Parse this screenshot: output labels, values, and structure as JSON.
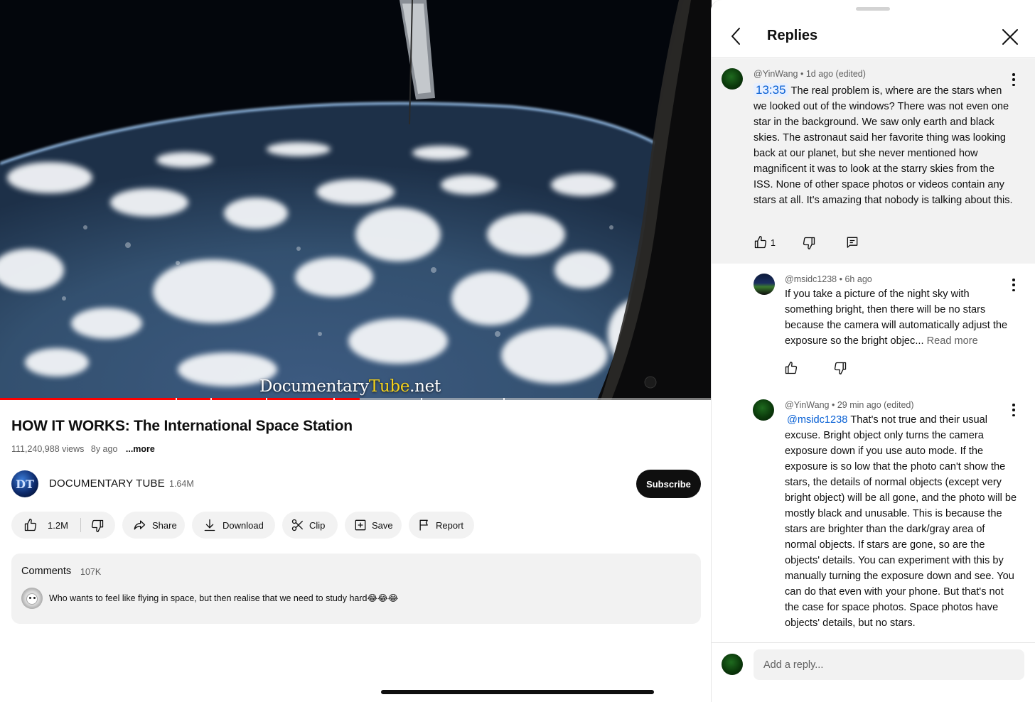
{
  "video": {
    "watermark_a": "Documentary",
    "watermark_b": "Tube",
    "watermark_c": ".net",
    "progress_fraction": 0.505,
    "title": "HOW IT WORKS: The International Space Station",
    "views": "111,240,988 views",
    "age": "8y ago",
    "more": "...more"
  },
  "channel": {
    "avatar_text": "DT",
    "name": "DOCUMENTARY TUBE",
    "subscribers": "1.64M",
    "subscribe_label": "Subscribe"
  },
  "actions": {
    "likes": "1.2M",
    "share": "Share",
    "download": "Download",
    "clip": "Clip",
    "save": "Save",
    "report": "Report"
  },
  "comments": {
    "title": "Comments",
    "count": "107K",
    "preview_text": "Who wants to feel like flying in space, but then realise that we need to study hard😂😂😂"
  },
  "replies_panel": {
    "title": "Replies",
    "input_placeholder": "Add a reply...",
    "parent": {
      "author": "@YinWang",
      "meta": "1d ago (edited)",
      "timestamp_link": "13:35",
      "text": "The real problem is, where are the stars when we looked out of the windows? There was not even one star in the background. We saw only earth and black skies. The astronaut said her favorite thing was looking back at our planet, but she never mentioned how magnificent it was to look at the starry skies from the ISS. None of other space photos or videos contain any stars at all. It's amazing that nobody is talking about this.",
      "likes": "1"
    },
    "replies": [
      {
        "author": "@msidc1238",
        "meta": "6h ago",
        "text": "If you take a picture of the night sky with something bright, then there will be no stars because the camera will automatically adjust the exposure so the bright objec...",
        "read_more": "Read more"
      },
      {
        "author": "@YinWang",
        "meta": "29 min ago (edited)",
        "mention": "@msidc1238",
        "text": "That's not true and their usual excuse. Bright object only turns the camera exposure down if you use auto mode. If the exposure is so low that the photo can't show the stars, the details of normal objects (except very bright object) will be all gone, and the photo will be mostly black and unusable. This is because the stars are brighter than the dark/gray area of normal objects. If stars are gone, so are the objects' details. You can experiment with this by manually turning the exposure down and see. You can do that even with your phone. But that's not the case for space photos. Space photos have objects' details, but no stars."
      }
    ]
  },
  "colors": {
    "accent_red": "#ff0000",
    "link_blue": "#065fd4",
    "surface": "#f2f2f2",
    "text": "#0f0f0f",
    "secondary_text": "#606060"
  },
  "icons": [
    "thumbs-up-icon",
    "thumbs-down-icon",
    "share-icon",
    "download-icon",
    "scissors-icon",
    "save-playlist-icon",
    "flag-icon",
    "reply-icon",
    "back-chevron-icon",
    "close-icon",
    "more-vert-icon"
  ]
}
